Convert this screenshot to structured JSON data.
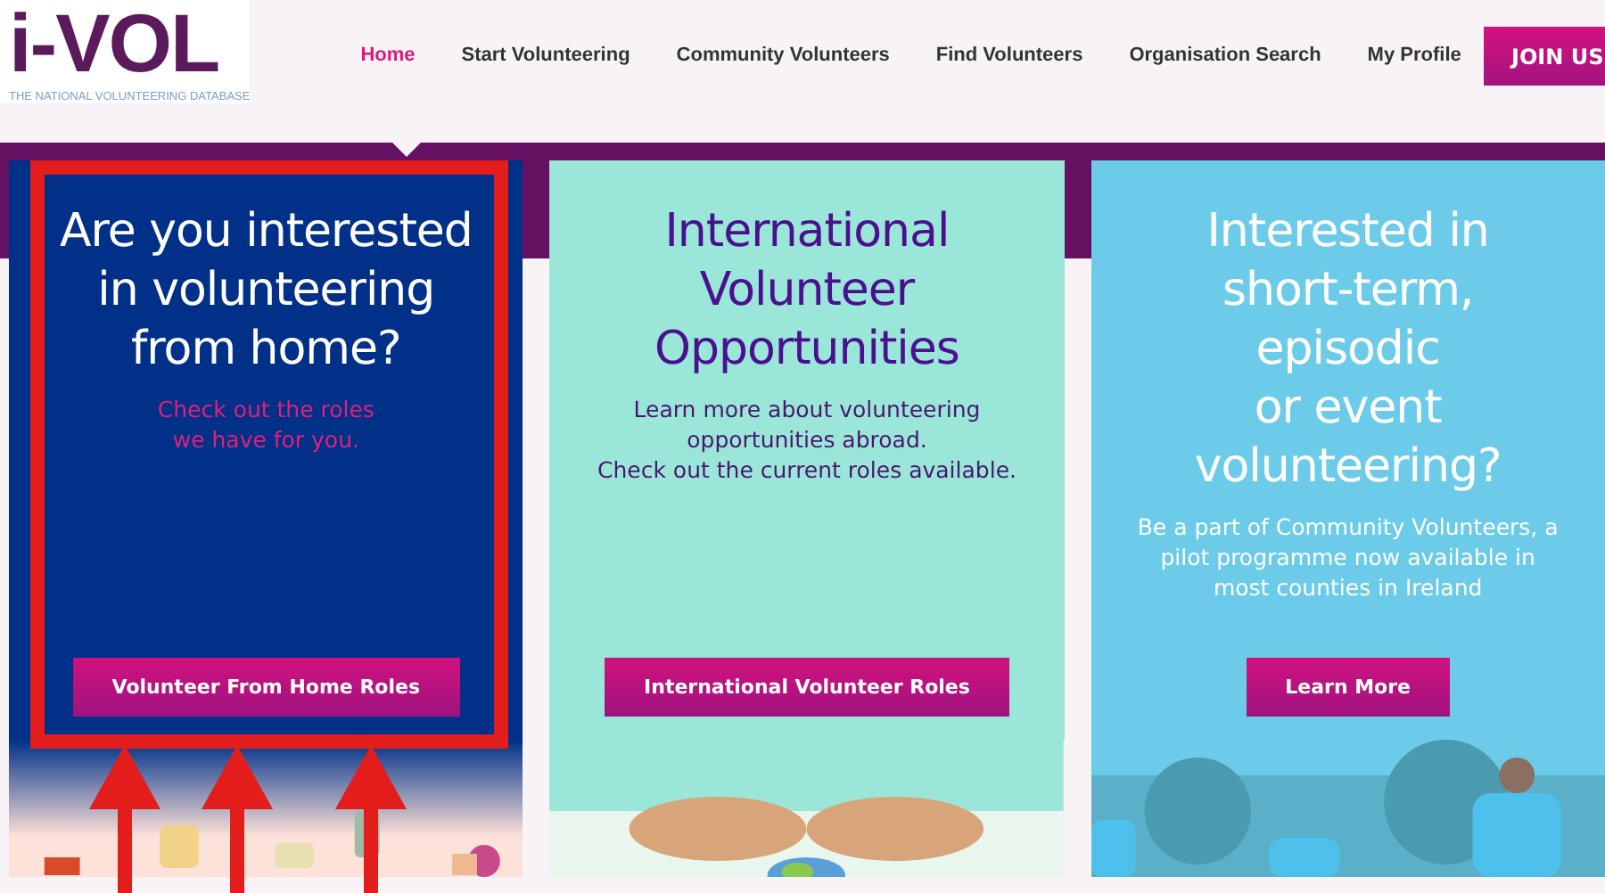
{
  "logo": {
    "title": "i-VOL",
    "tagline": "THE NATIONAL VOLUNTEERING DATABASE"
  },
  "nav": [
    {
      "label": "Home",
      "selected": true
    },
    {
      "label": "Start Volunteering",
      "selected": false
    },
    {
      "label": "Community Volunteers",
      "selected": false
    },
    {
      "label": "Find Volunteers",
      "selected": false
    },
    {
      "label": "Organisation Search",
      "selected": false
    },
    {
      "label": "My Profile",
      "selected": false
    }
  ],
  "join_button": "JOIN US",
  "cards": [
    {
      "kind": "blue",
      "highlighted": true,
      "title": "Are you interested\nin volunteering\nfrom home?",
      "text": "Check out the roles\nwe have for you.",
      "button": "Volunteer From Home Roles"
    },
    {
      "kind": "mint",
      "highlighted": false,
      "title": "International\nVolunteer\nOpportunities",
      "text": "Learn more about volunteering\nopportunities abroad.\nCheck out the current roles available.",
      "button": "International Volunteer Roles"
    },
    {
      "kind": "sky",
      "highlighted": false,
      "title": "Interested in\nshort-term,\nepisodic\nor event\nvolunteering?",
      "text": "Be a part of Community Volunteers, a\npilot programme now available in\nmost counties in Ireland",
      "button": "Learn More"
    }
  ]
}
